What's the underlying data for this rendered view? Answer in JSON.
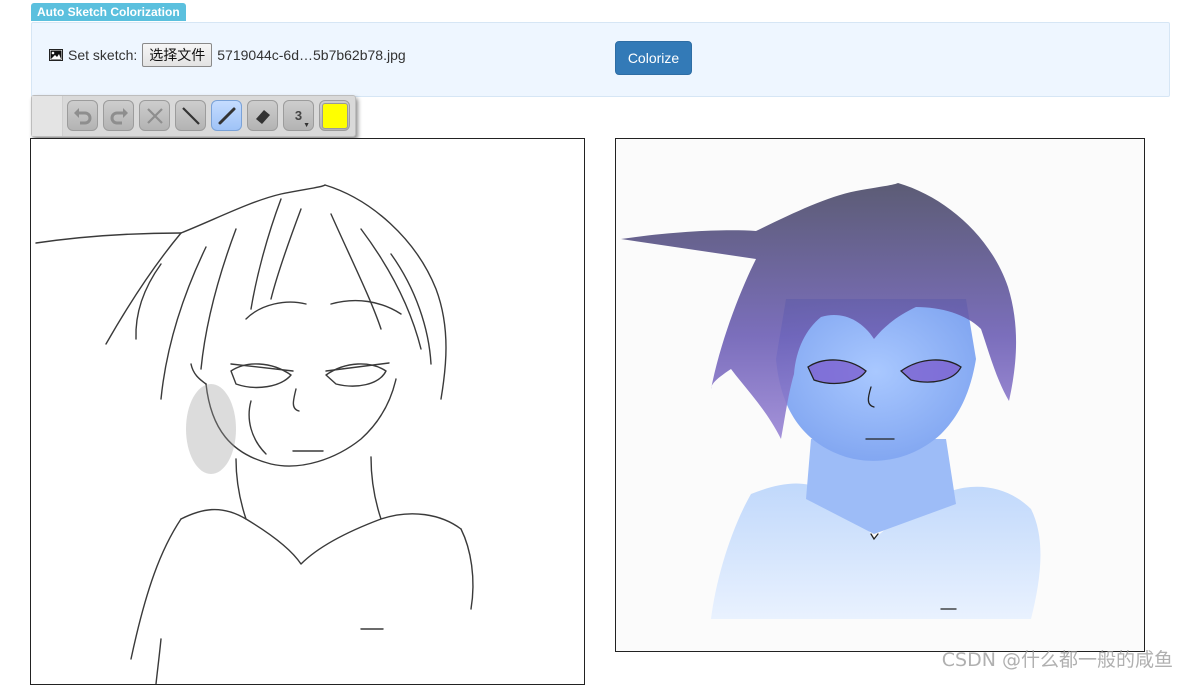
{
  "app": {
    "badge": "Auto Sketch Colorization"
  },
  "sketch_panel": {
    "label": "Set sketch:",
    "file_button": "选择文件",
    "file_name": "5719044c-6d…5b7b62b78.jpg",
    "colorize_button": "Colorize"
  },
  "toolbar": {
    "tools": [
      {
        "name": "undo-icon",
        "state": "disabled"
      },
      {
        "name": "redo-icon",
        "state": "disabled"
      },
      {
        "name": "clear-icon",
        "state": "disabled"
      },
      {
        "name": "line-icon",
        "state": "enabled"
      },
      {
        "name": "pencil-icon",
        "state": "active"
      },
      {
        "name": "eraser-icon",
        "state": "enabled"
      },
      {
        "name": "brush-size-icon",
        "state": "enabled"
      },
      {
        "name": "color-swatch-icon",
        "state": "enabled"
      }
    ],
    "brush_size": "3",
    "brush_color": "#ffff00",
    "active_color": "#9fc3f7"
  },
  "colors": {
    "badge": "#5bc0de",
    "panel": "#eef6ff",
    "primary": "#337ab7"
  },
  "watermark": "CSDN @什么都一般的咸鱼"
}
